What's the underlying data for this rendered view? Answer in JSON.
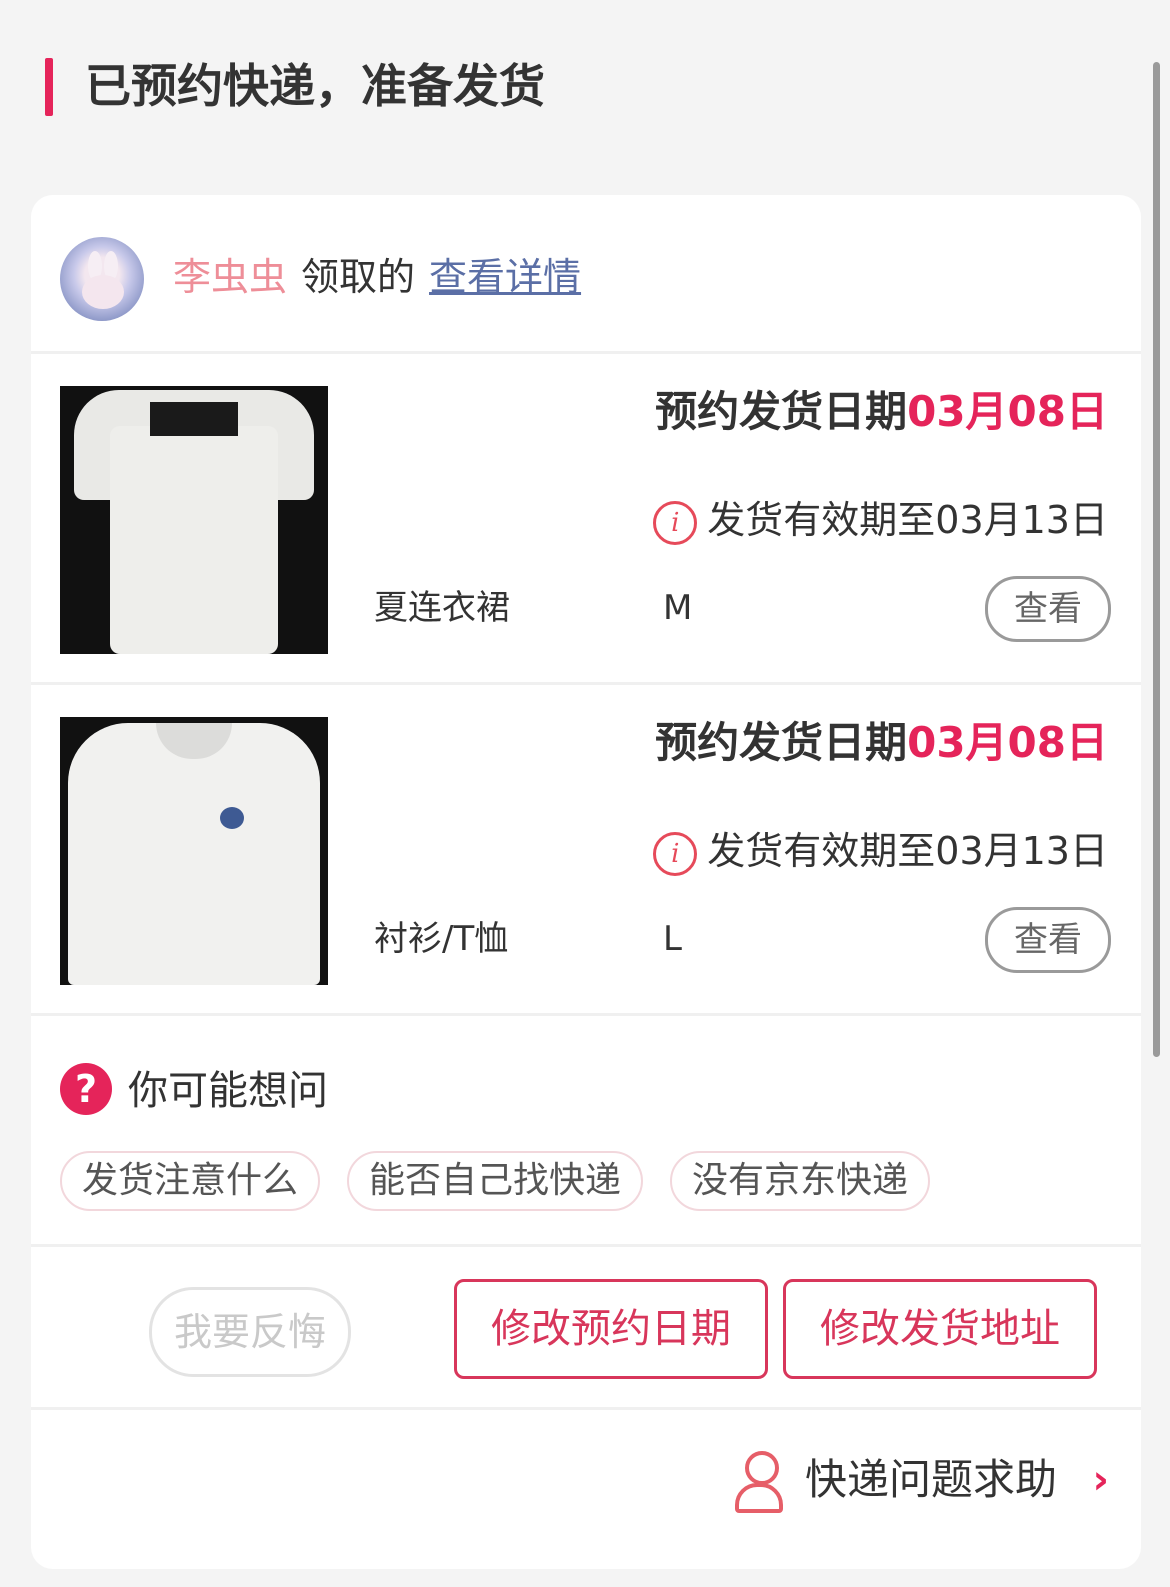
{
  "status": {
    "title": "已预约快递，准备发货"
  },
  "claim": {
    "name": "李虫虫",
    "text": "领取的",
    "link": "查看详情"
  },
  "items": [
    {
      "schedule_label": "预约发货日期",
      "schedule_date": "03月08日",
      "validity": "发货有效期至03月13日",
      "name": "夏连衣裙",
      "size": "M",
      "view_label": "查看"
    },
    {
      "schedule_label": "预约发货日期",
      "schedule_date": "03月08日",
      "validity": "发货有效期至03月13日",
      "name": "衬衫/T恤",
      "size": "L",
      "view_label": "查看"
    }
  ],
  "faq": {
    "title": "你可能想问",
    "chips": [
      "发货注意什么",
      "能否自己找快递",
      "没有京东快递"
    ]
  },
  "actions": {
    "regret": "我要反悔",
    "change_date": "修改预约日期",
    "change_address": "修改发货地址"
  },
  "help": {
    "label": "快递问题求助"
  },
  "colors": {
    "accent": "#e5245a",
    "claim_name": "#ee8e98",
    "link": "#5b6fa6"
  }
}
